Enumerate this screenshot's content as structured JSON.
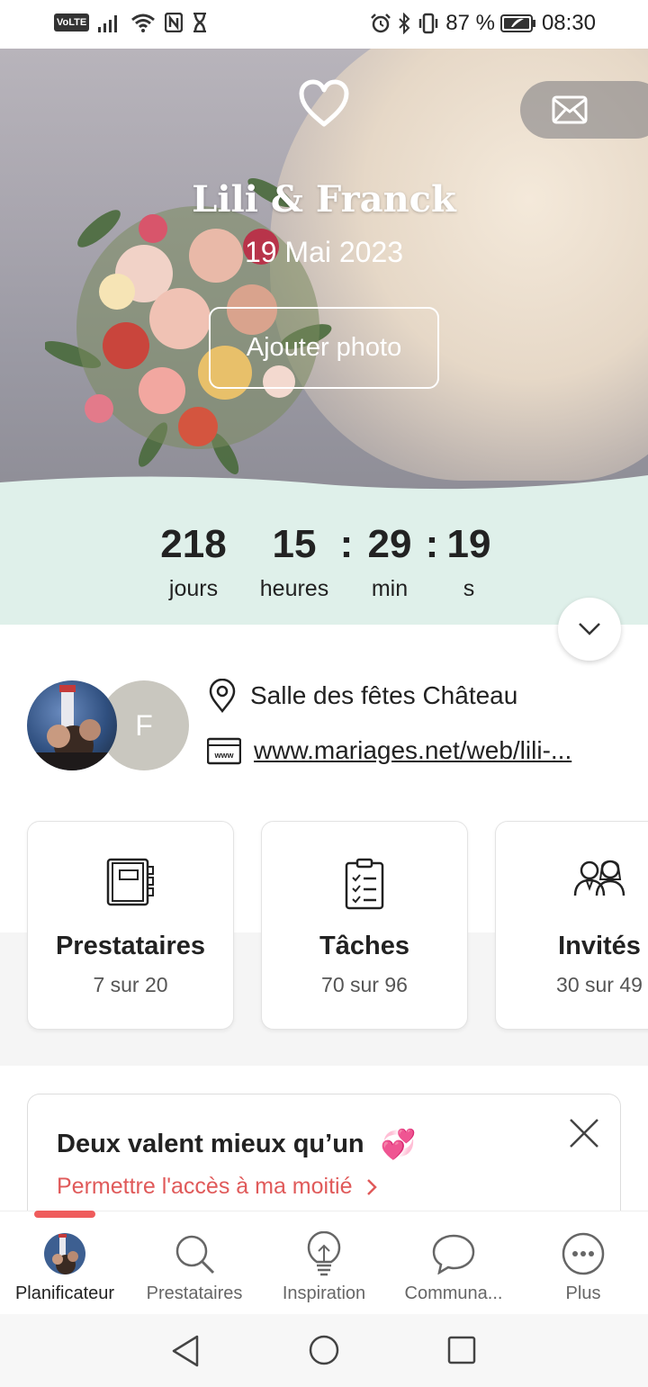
{
  "status_bar": {
    "volte": "VoLTE",
    "battery_percent": "87 %",
    "time": "08:30"
  },
  "hero": {
    "couple_names": "Lili & Franck",
    "wedding_date": "19 Mai 2023",
    "add_photo_label": "Ajouter photo"
  },
  "countdown": {
    "days_value": "218",
    "days_label": "jours",
    "hours_value": "15",
    "hours_label": "heures",
    "sep1": ":",
    "minutes_value": "29",
    "minutes_label": "min",
    "sep2": ":",
    "seconds_value": "19",
    "seconds_label": "s"
  },
  "profile": {
    "partner_initial": "F",
    "venue": "Salle des fêtes Château",
    "website": "www.mariages.net/web/lili-..."
  },
  "cards": [
    {
      "title": "Prestataires",
      "subtitle": "7 sur 20",
      "icon": "notebook-icon"
    },
    {
      "title": "Tâches",
      "subtitle": "70 sur 96",
      "icon": "checklist-icon"
    },
    {
      "title": "Invités",
      "subtitle": "30 sur 49",
      "icon": "guests-icon"
    }
  ],
  "promo": {
    "title": "Deux valent mieux qu’un",
    "emoji": "💞",
    "link": "Permettre l'accès à ma moitié"
  },
  "bottom_nav": [
    {
      "label": "Planificateur",
      "active": true
    },
    {
      "label": "Prestataires",
      "active": false
    },
    {
      "label": "Inspiration",
      "active": false
    },
    {
      "label": "Communa...",
      "active": false
    },
    {
      "label": "Plus",
      "active": false
    }
  ],
  "colors": {
    "accent": "#ef5c5c",
    "promo_link": "#e05a5a",
    "countdown_bg": "#dff0ea"
  }
}
